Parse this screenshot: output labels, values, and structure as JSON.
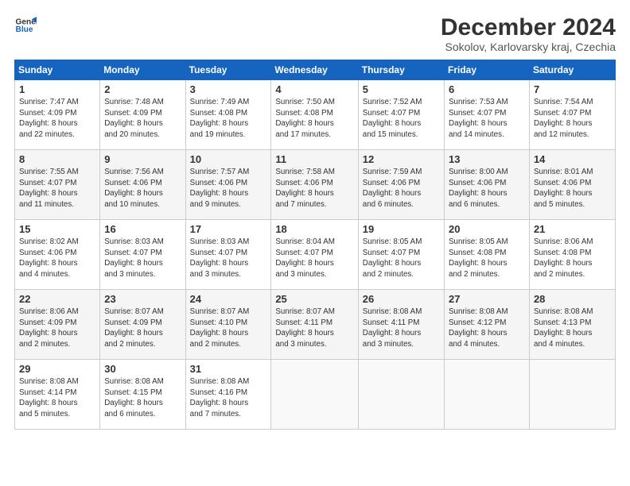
{
  "header": {
    "logo_line1": "General",
    "logo_line2": "Blue",
    "month": "December 2024",
    "location": "Sokolov, Karlovarsky kraj, Czechia"
  },
  "columns": [
    "Sunday",
    "Monday",
    "Tuesday",
    "Wednesday",
    "Thursday",
    "Friday",
    "Saturday"
  ],
  "weeks": [
    [
      {
        "day": "1",
        "info": "Sunrise: 7:47 AM\nSunset: 4:09 PM\nDaylight: 8 hours\nand 22 minutes."
      },
      {
        "day": "2",
        "info": "Sunrise: 7:48 AM\nSunset: 4:09 PM\nDaylight: 8 hours\nand 20 minutes."
      },
      {
        "day": "3",
        "info": "Sunrise: 7:49 AM\nSunset: 4:08 PM\nDaylight: 8 hours\nand 19 minutes."
      },
      {
        "day": "4",
        "info": "Sunrise: 7:50 AM\nSunset: 4:08 PM\nDaylight: 8 hours\nand 17 minutes."
      },
      {
        "day": "5",
        "info": "Sunrise: 7:52 AM\nSunset: 4:07 PM\nDaylight: 8 hours\nand 15 minutes."
      },
      {
        "day": "6",
        "info": "Sunrise: 7:53 AM\nSunset: 4:07 PM\nDaylight: 8 hours\nand 14 minutes."
      },
      {
        "day": "7",
        "info": "Sunrise: 7:54 AM\nSunset: 4:07 PM\nDaylight: 8 hours\nand 12 minutes."
      }
    ],
    [
      {
        "day": "8",
        "info": "Sunrise: 7:55 AM\nSunset: 4:07 PM\nDaylight: 8 hours\nand 11 minutes."
      },
      {
        "day": "9",
        "info": "Sunrise: 7:56 AM\nSunset: 4:06 PM\nDaylight: 8 hours\nand 10 minutes."
      },
      {
        "day": "10",
        "info": "Sunrise: 7:57 AM\nSunset: 4:06 PM\nDaylight: 8 hours\nand 9 minutes."
      },
      {
        "day": "11",
        "info": "Sunrise: 7:58 AM\nSunset: 4:06 PM\nDaylight: 8 hours\nand 7 minutes."
      },
      {
        "day": "12",
        "info": "Sunrise: 7:59 AM\nSunset: 4:06 PM\nDaylight: 8 hours\nand 6 minutes."
      },
      {
        "day": "13",
        "info": "Sunrise: 8:00 AM\nSunset: 4:06 PM\nDaylight: 8 hours\nand 6 minutes."
      },
      {
        "day": "14",
        "info": "Sunrise: 8:01 AM\nSunset: 4:06 PM\nDaylight: 8 hours\nand 5 minutes."
      }
    ],
    [
      {
        "day": "15",
        "info": "Sunrise: 8:02 AM\nSunset: 4:06 PM\nDaylight: 8 hours\nand 4 minutes."
      },
      {
        "day": "16",
        "info": "Sunrise: 8:03 AM\nSunset: 4:07 PM\nDaylight: 8 hours\nand 3 minutes."
      },
      {
        "day": "17",
        "info": "Sunrise: 8:03 AM\nSunset: 4:07 PM\nDaylight: 8 hours\nand 3 minutes."
      },
      {
        "day": "18",
        "info": "Sunrise: 8:04 AM\nSunset: 4:07 PM\nDaylight: 8 hours\nand 3 minutes."
      },
      {
        "day": "19",
        "info": "Sunrise: 8:05 AM\nSunset: 4:07 PM\nDaylight: 8 hours\nand 2 minutes."
      },
      {
        "day": "20",
        "info": "Sunrise: 8:05 AM\nSunset: 4:08 PM\nDaylight: 8 hours\nand 2 minutes."
      },
      {
        "day": "21",
        "info": "Sunrise: 8:06 AM\nSunset: 4:08 PM\nDaylight: 8 hours\nand 2 minutes."
      }
    ],
    [
      {
        "day": "22",
        "info": "Sunrise: 8:06 AM\nSunset: 4:09 PM\nDaylight: 8 hours\nand 2 minutes."
      },
      {
        "day": "23",
        "info": "Sunrise: 8:07 AM\nSunset: 4:09 PM\nDaylight: 8 hours\nand 2 minutes."
      },
      {
        "day": "24",
        "info": "Sunrise: 8:07 AM\nSunset: 4:10 PM\nDaylight: 8 hours\nand 2 minutes."
      },
      {
        "day": "25",
        "info": "Sunrise: 8:07 AM\nSunset: 4:11 PM\nDaylight: 8 hours\nand 3 minutes."
      },
      {
        "day": "26",
        "info": "Sunrise: 8:08 AM\nSunset: 4:11 PM\nDaylight: 8 hours\nand 3 minutes."
      },
      {
        "day": "27",
        "info": "Sunrise: 8:08 AM\nSunset: 4:12 PM\nDaylight: 8 hours\nand 4 minutes."
      },
      {
        "day": "28",
        "info": "Sunrise: 8:08 AM\nSunset: 4:13 PM\nDaylight: 8 hours\nand 4 minutes."
      }
    ],
    [
      {
        "day": "29",
        "info": "Sunrise: 8:08 AM\nSunset: 4:14 PM\nDaylight: 8 hours\nand 5 minutes."
      },
      {
        "day": "30",
        "info": "Sunrise: 8:08 AM\nSunset: 4:15 PM\nDaylight: 8 hours\nand 6 minutes."
      },
      {
        "day": "31",
        "info": "Sunrise: 8:08 AM\nSunset: 4:16 PM\nDaylight: 8 hours\nand 7 minutes."
      },
      {
        "day": "",
        "info": ""
      },
      {
        "day": "",
        "info": ""
      },
      {
        "day": "",
        "info": ""
      },
      {
        "day": "",
        "info": ""
      }
    ]
  ]
}
